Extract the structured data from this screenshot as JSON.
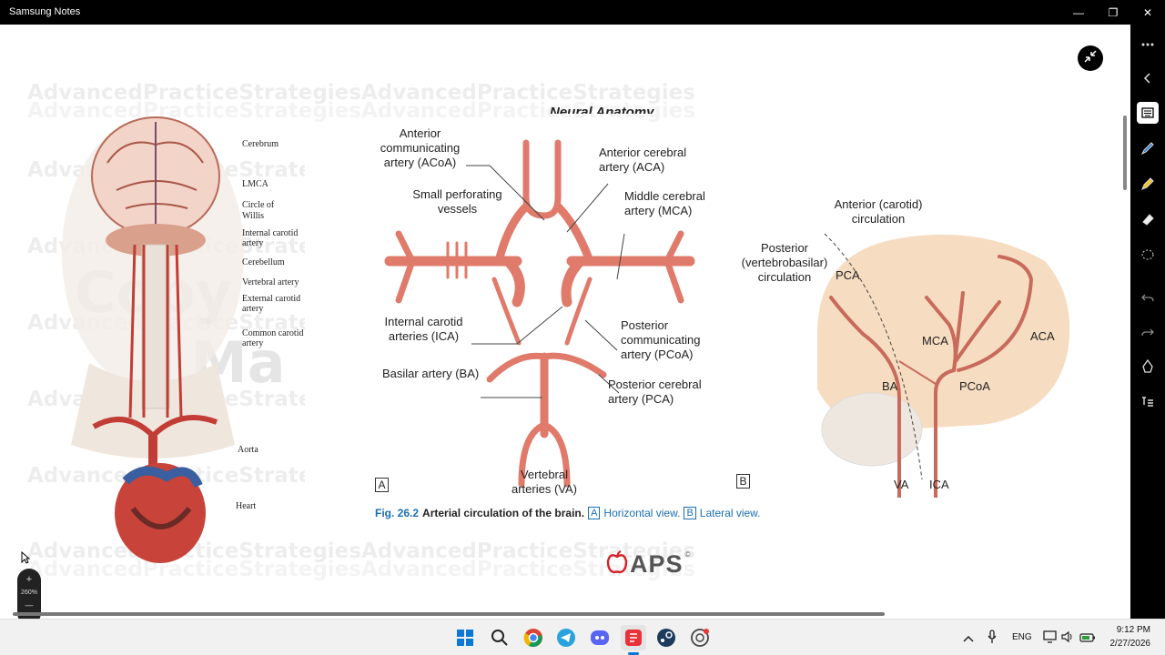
{
  "app": {
    "title": "Samsung Notes"
  },
  "window_controls": {
    "minimize": "—",
    "maximize": "❐",
    "close": "✕"
  },
  "watermark": {
    "text": "AdvancedPracticeStrategiesAdvancedPracticeStrategies",
    "copy_text": "Copy",
    "ma_text": "Ma"
  },
  "left_figure": {
    "labels": [
      "Cerebrum",
      "LMCA",
      "Circle of",
      "Willis",
      "Internal carotid",
      "artery",
      "Cerebellum",
      "Vertebral artery",
      "External carotid",
      "artery",
      "Common carotid",
      "artery",
      "Aorta",
      "Heart"
    ]
  },
  "partial_heading": "Neural Anatomy",
  "fig_a": {
    "box_label": "A",
    "labels": {
      "acoa": [
        "Anterior",
        "communicating",
        "artery (ACoA)"
      ],
      "aca": [
        "Anterior cerebral",
        "artery (ACA)"
      ],
      "perforating": [
        "Small perforating",
        "vessels"
      ],
      "mca": [
        "Middle cerebral",
        "artery (MCA)"
      ],
      "ica": [
        "Internal carotid",
        "arteries (ICA)"
      ],
      "pcoa": [
        "Posterior",
        "communicating",
        "artery (PCoA)"
      ],
      "ba": "Basilar artery (BA)",
      "pca": [
        "Posterior cerebral",
        "artery (PCA)"
      ],
      "va": [
        "Vertebral",
        "arteries (VA)"
      ]
    }
  },
  "fig_b": {
    "box_label": "B",
    "labels": {
      "anterior": [
        "Anterior (carotid)",
        "circulation"
      ],
      "posterior": [
        "Posterior",
        "(vertebrobasilar)",
        "circulation"
      ],
      "pca": "PCA",
      "mca": "MCA",
      "aca": "ACA",
      "ba": "BA",
      "pcoa": "PCoA",
      "va": "VA",
      "ica": "ICA"
    }
  },
  "caption": {
    "fig": "Fig. 26.2",
    "title": "Arterial circulation of the brain.",
    "a_box": "A",
    "a_text": "Horizontal view.",
    "b_box": "B",
    "b_text": "Lateral view."
  },
  "logo": {
    "text": "APS",
    "mark": "©"
  },
  "zoom": {
    "value": "260%",
    "plus": "+",
    "minus": "—"
  },
  "right_toolbar": [
    "more-icon",
    "collapse-icon",
    "keyboard-icon",
    "pen-icon",
    "highlighter-icon",
    "eraser-icon",
    "lasso-icon",
    "undo-icon",
    "redo-icon",
    "pen-mode-icon",
    "text-icon"
  ],
  "taskbar": {
    "apps": [
      "windows-start-icon",
      "search-icon",
      "chrome-icon",
      "telegram-icon",
      "discord-icon",
      "samsung-notes-icon",
      "steam-icon",
      "chatgpt-icon"
    ],
    "lang": "ENG",
    "time": "9:12 PM",
    "date": "2/27/2026"
  },
  "colors": {
    "artery": "#e07a6a",
    "artery_dark": "#c4564a",
    "brain": "#f6dcc0",
    "accent_blue": "#1a6fb3"
  }
}
